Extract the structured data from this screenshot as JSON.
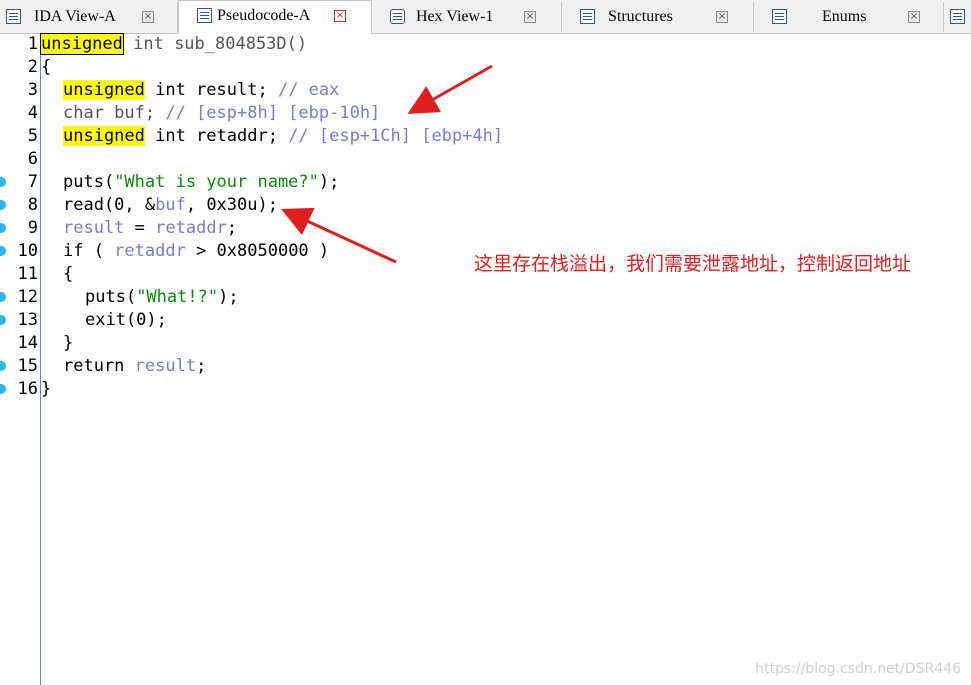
{
  "tabs": [
    {
      "label": "IDA View-A",
      "close": "×"
    },
    {
      "label": "Pseudocode-A",
      "close": "×"
    },
    {
      "label": "Hex View-1",
      "close": "×"
    },
    {
      "label": "Structures",
      "close": "×"
    },
    {
      "label": "Enums",
      "close": "×"
    }
  ],
  "code": {
    "line_numbers": [
      "1",
      "2",
      "3",
      "4",
      "5",
      "6",
      "7",
      "8",
      "9",
      "10",
      "11",
      "12",
      "13",
      "14",
      "15",
      "16"
    ],
    "l1": {
      "kw": "unsigned",
      "rest": " int sub_804853D()"
    },
    "l2": "{",
    "l3": {
      "kw": "unsigned",
      "mid": " int result; ",
      "cmt": "// eax"
    },
    "l4": {
      "pre": "char buf; ",
      "cmt": "// [esp+8h] [ebp-10h]"
    },
    "l5": {
      "kw": "unsigned",
      "mid": " int retaddr; ",
      "cmt": "// [esp+1Ch] [ebp+4h]"
    },
    "l7": {
      "a": "puts(",
      "s": "\"What is your name?\"",
      "b": ");"
    },
    "l8": {
      "a": "read(0, &",
      "v": "buf",
      "b": ", 0x30u);"
    },
    "l9": {
      "v1": "result",
      "a": " = ",
      "v2": "retaddr",
      "b": ";"
    },
    "l10": {
      "a": "if ( ",
      "v": "retaddr",
      "b": " > 0x8050000 )"
    },
    "l11": "{",
    "l12": {
      "a": "puts(",
      "s": "\"What!?\"",
      "b": ");"
    },
    "l13": "exit(0);",
    "l14": "}",
    "l15": {
      "a": "return ",
      "v": "result",
      "b": ";"
    },
    "l16": "}"
  },
  "annotation": "这里存在栈溢出，我们需要泄露地址，控制返回地址",
  "watermark": "https://blog.csdn.net/DSR446",
  "colors": {
    "highlight": "#ffff00",
    "annotation": "#e02020",
    "breakpoint": "#29b6f6",
    "comment": "#7b7bd6",
    "string": "#0a8a0a"
  }
}
